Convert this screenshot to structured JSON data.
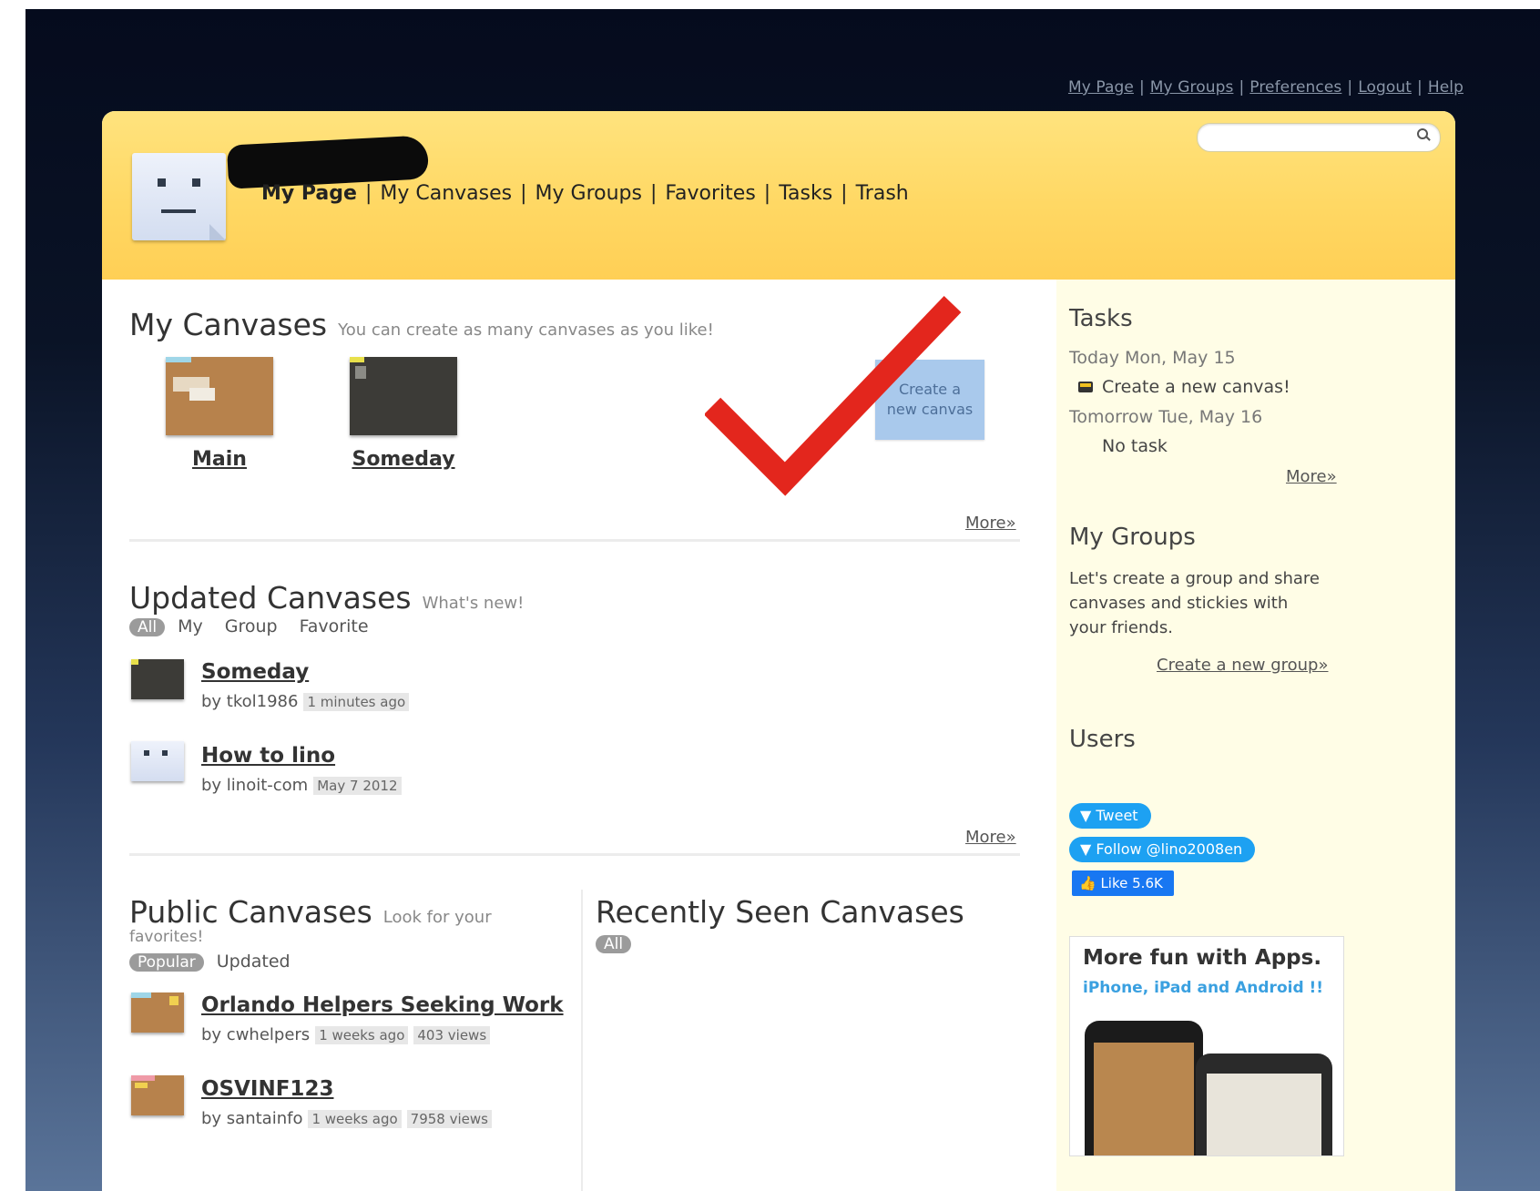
{
  "top_links": [
    "My Page",
    "My Groups",
    "Preferences",
    "Logout",
    "Help"
  ],
  "header": {
    "nav": [
      "My Page",
      "My Canvases",
      "My Groups",
      "Favorites",
      "Tasks",
      "Trash"
    ],
    "search_placeholder": ""
  },
  "my_canvases": {
    "title": "My Canvases",
    "subtitle": "You can create as many canvases as you like!",
    "canvases": [
      "Main",
      "Someday"
    ],
    "create_label": "Create a new canvas",
    "more": "More»"
  },
  "updated_canvases": {
    "title": "Updated Canvases",
    "subtitle": "What's new!",
    "filters": [
      "All",
      "My",
      "Group",
      "Favorite"
    ],
    "items": [
      {
        "title": "Someday",
        "by": "by tkol1986",
        "time": "1 minutes ago"
      },
      {
        "title": "How to lino",
        "by": "by linoit-com",
        "time": "May 7 2012"
      }
    ],
    "more": "More»"
  },
  "public_canvases": {
    "title": "Public Canvases",
    "subtitle_line1": "Look for your",
    "subtitle_line2": "favorites!",
    "filters": [
      "Popular",
      "Updated"
    ],
    "items": [
      {
        "title": "Orlando Helpers Seeking Work",
        "by": "by cwhelpers",
        "time": "1 weeks ago",
        "views": "403 views"
      },
      {
        "title": "OSVINF123",
        "by": "by santainfo",
        "time": "1 weeks ago",
        "views": "7958 views"
      }
    ]
  },
  "recently_seen": {
    "title": "Recently Seen Canvases",
    "filters": [
      "All"
    ]
  },
  "sidebar": {
    "tasks": {
      "title": "Tasks",
      "today": "Today Mon, May 15",
      "task": "Create a new canvas!",
      "tomorrow": "Tomorrow Tue, May 16",
      "no_task": "No task",
      "more": "More»"
    },
    "groups": {
      "title": "My Groups",
      "text_line1": "Let's create a group and share",
      "text_line2": "canvases and stickies with",
      "text_line3": "your friends.",
      "link": "Create a new group»"
    },
    "users": {
      "title": "Users"
    },
    "social": {
      "tweet": "Tweet",
      "follow": "Follow @lino2008en",
      "like": "Like 5.6K"
    },
    "apps": {
      "title": "More fun with Apps.",
      "subtitle": "iPhone, iPad and Android !!"
    }
  },
  "colors": {
    "header_yellow": "#ffd864",
    "sidebar_bg": "#fffde6",
    "checkmark": "#e3261d",
    "create_button": "#a9c9ec"
  }
}
